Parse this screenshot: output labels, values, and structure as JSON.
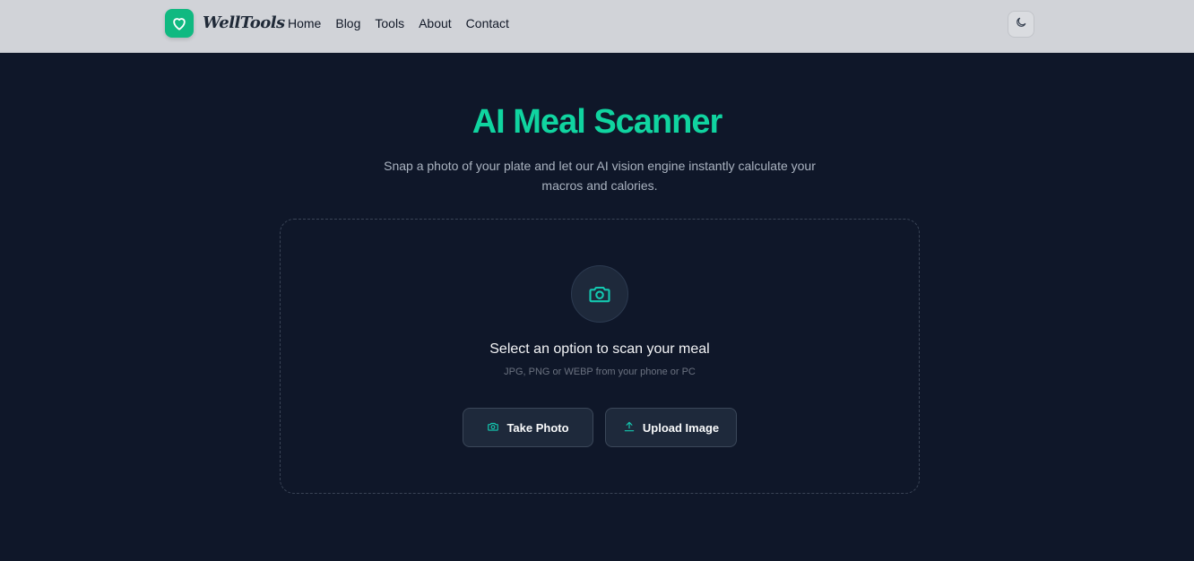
{
  "header": {
    "logo_text": "WellTools",
    "nav": [
      "Home",
      "Blog",
      "Tools",
      "About",
      "Contact"
    ],
    "theme_toggle_icon": "moon-icon"
  },
  "hero": {
    "title": "AI Meal Scanner",
    "subtitle": "Snap a photo of your plate and let our AI vision engine instantly calculate your macros and calories."
  },
  "scanner": {
    "icon": "camera-icon",
    "title": "Select an option to scan your meal",
    "subtitle": "JPG, PNG or WEBP from your phone or PC",
    "take_photo_label": "Take Photo",
    "upload_label": "Upload Image"
  },
  "colors": {
    "accent": "#10d4a0",
    "logo_badge": "#10b981",
    "background": "#0f1729",
    "header": "#d1d3d8"
  }
}
